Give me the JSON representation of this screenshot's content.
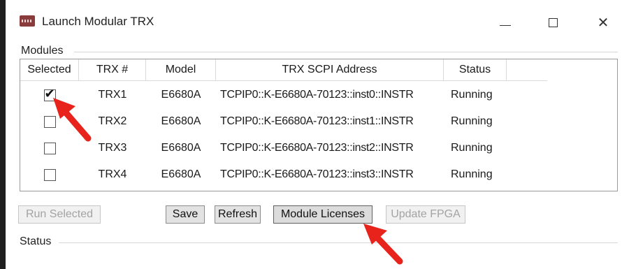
{
  "window": {
    "title": "Launch Modular TRX",
    "icon": "app-logo-icon",
    "controls": {
      "minimize": "minimize-icon",
      "maximize": "maximize-icon",
      "close": "close-icon"
    }
  },
  "modules": {
    "group_label": "Modules",
    "columns": [
      "Selected",
      "TRX #",
      "Model",
      "TRX SCPI Address",
      "Status"
    ],
    "rows": [
      {
        "selected": true,
        "trx": "TRX1",
        "model": "E6680A",
        "address": "TCPIP0::K-E6680A-70123::inst0::INSTR",
        "status": "Running"
      },
      {
        "selected": false,
        "trx": "TRX2",
        "model": "E6680A",
        "address": "TCPIP0::K-E6680A-70123::inst1::INSTR",
        "status": "Running"
      },
      {
        "selected": false,
        "trx": "TRX3",
        "model": "E6680A",
        "address": "TCPIP0::K-E6680A-70123::inst2::INSTR",
        "status": "Running"
      },
      {
        "selected": false,
        "trx": "TRX4",
        "model": "E6680A",
        "address": "TCPIP0::K-E6680A-70123::inst3::INSTR",
        "status": "Running"
      }
    ]
  },
  "buttons": {
    "run_selected": "Run Selected",
    "save": "Save",
    "refresh": "Refresh",
    "module_licenses": "Module Licenses",
    "update_fpga": "Update FPGA"
  },
  "status": {
    "group_label": "Status"
  },
  "colors": {
    "annotation_arrow": "#e8231b",
    "title_icon": "#8a3b3b"
  }
}
